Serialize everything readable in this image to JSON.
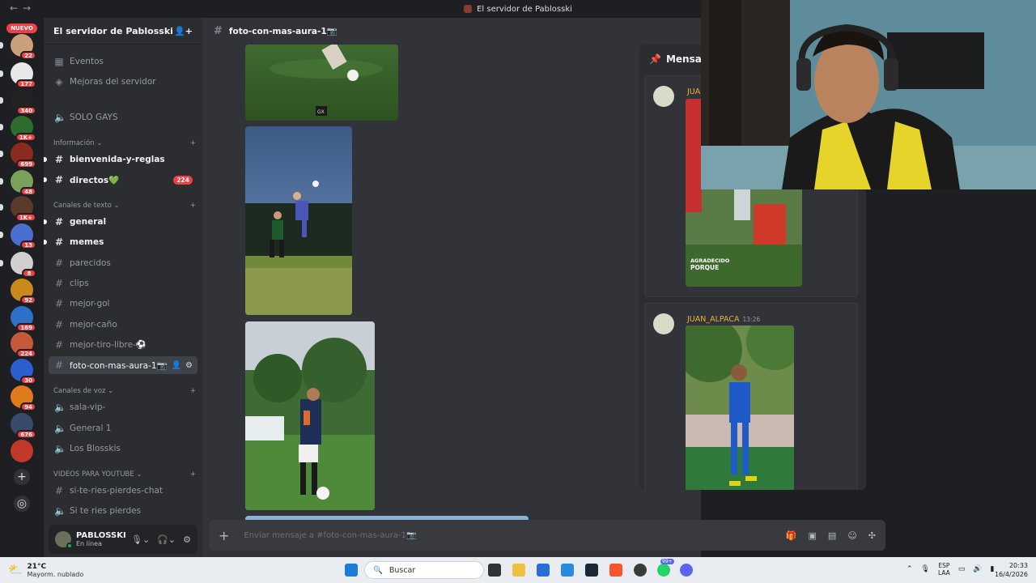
{
  "window": {
    "title": "El servidor de Pablosski"
  },
  "rail": {
    "new_label": "NUEVO",
    "servers": [
      {
        "badge": "22",
        "color": "#c9a07a"
      },
      {
        "badge": "177",
        "color": "#e8e8e8"
      },
      {
        "badge": "340",
        "color": "#222222"
      },
      {
        "badge": "1K+",
        "color": "#2e6b2e"
      },
      {
        "badge": "699",
        "color": "#8b2a1f"
      },
      {
        "badge": "48",
        "color": "#7aa05a"
      },
      {
        "badge": "1K+",
        "color": "#5a3a2a"
      },
      {
        "badge": "13",
        "color": "#4a6fd0"
      },
      {
        "badge": "8",
        "color": "#d0d0d0"
      },
      {
        "badge": "92",
        "color": "#c98a1a"
      },
      {
        "badge": "169",
        "color": "#2f6fc8"
      },
      {
        "badge": "224",
        "color": "#c45a3a"
      },
      {
        "badge": "30",
        "color": "#2b5fd0"
      },
      {
        "badge": "94",
        "color": "#e07a1a"
      },
      {
        "badge": "676",
        "color": "#3a4a6a"
      },
      {
        "badge": "",
        "color": "#c0392b"
      }
    ]
  },
  "sidebar": {
    "server_name": "El servidor de Pablosski",
    "items_top": [
      {
        "label": "Eventos",
        "icon": "calendar-icon"
      },
      {
        "label": "Mejoras del servidor",
        "icon": "boost-icon"
      },
      {
        "label": "SOLO GAYS",
        "icon": "speaker-icon"
      }
    ],
    "categories": {
      "info": "Información",
      "text": "Canales de texto",
      "voice": "Canales de voz",
      "youtube": "VIDEOS PARA YOUTUBE"
    },
    "info_channels": [
      {
        "label": "bienvenida-y-reglas",
        "unread": true
      },
      {
        "label": "directos💚",
        "unread": true,
        "count": "224"
      }
    ],
    "text_channels": [
      {
        "label": "general",
        "unread": true
      },
      {
        "label": "memes",
        "unread": true
      },
      {
        "label": "parecidos",
        "unread": false
      },
      {
        "label": "clips",
        "unread": false
      },
      {
        "label": "mejor-gol",
        "unread": false
      },
      {
        "label": "mejor-caño",
        "unread": false
      },
      {
        "label": "mejor-tiro-libre-⚽",
        "unread": false
      },
      {
        "label": "foto-con-mas-aura-1📷",
        "unread": false,
        "active": true
      }
    ],
    "voice_channels": [
      {
        "label": "sala-vip-"
      },
      {
        "label": "General 1"
      },
      {
        "label": "Los Blosskis"
      }
    ],
    "youtube_channels": [
      {
        "label": "si-te-ries-pierdes-chat",
        "icon": "hash"
      },
      {
        "label": "Si te ries pierdes",
        "icon": "speaker"
      }
    ],
    "user": {
      "name": "PABLOSSKI",
      "status": "En línea"
    }
  },
  "main": {
    "channel_name": "foto-con-mas-aura-1📷",
    "composer_placeholder": "Enviar mensaje a #foto-con-mas-aura-1📷",
    "watermark": "GX"
  },
  "pinned": {
    "title": "Mensaje",
    "messages": [
      {
        "author": "JUA",
        "time": "",
        "caption_1": "AGRADECIDO",
        "caption_2": "PORQUE"
      },
      {
        "author": "JUAN_ALPACA",
        "time": "13:26"
      }
    ]
  },
  "taskbar": {
    "weather_temp": "21°C",
    "weather_desc": "Mayorm. nublado",
    "search_label": "Buscar",
    "lang_1": "ESP",
    "lang_2": "LAA",
    "time": "20:33",
    "date": "16/4/2026",
    "whatsapp_badge": "99+"
  }
}
